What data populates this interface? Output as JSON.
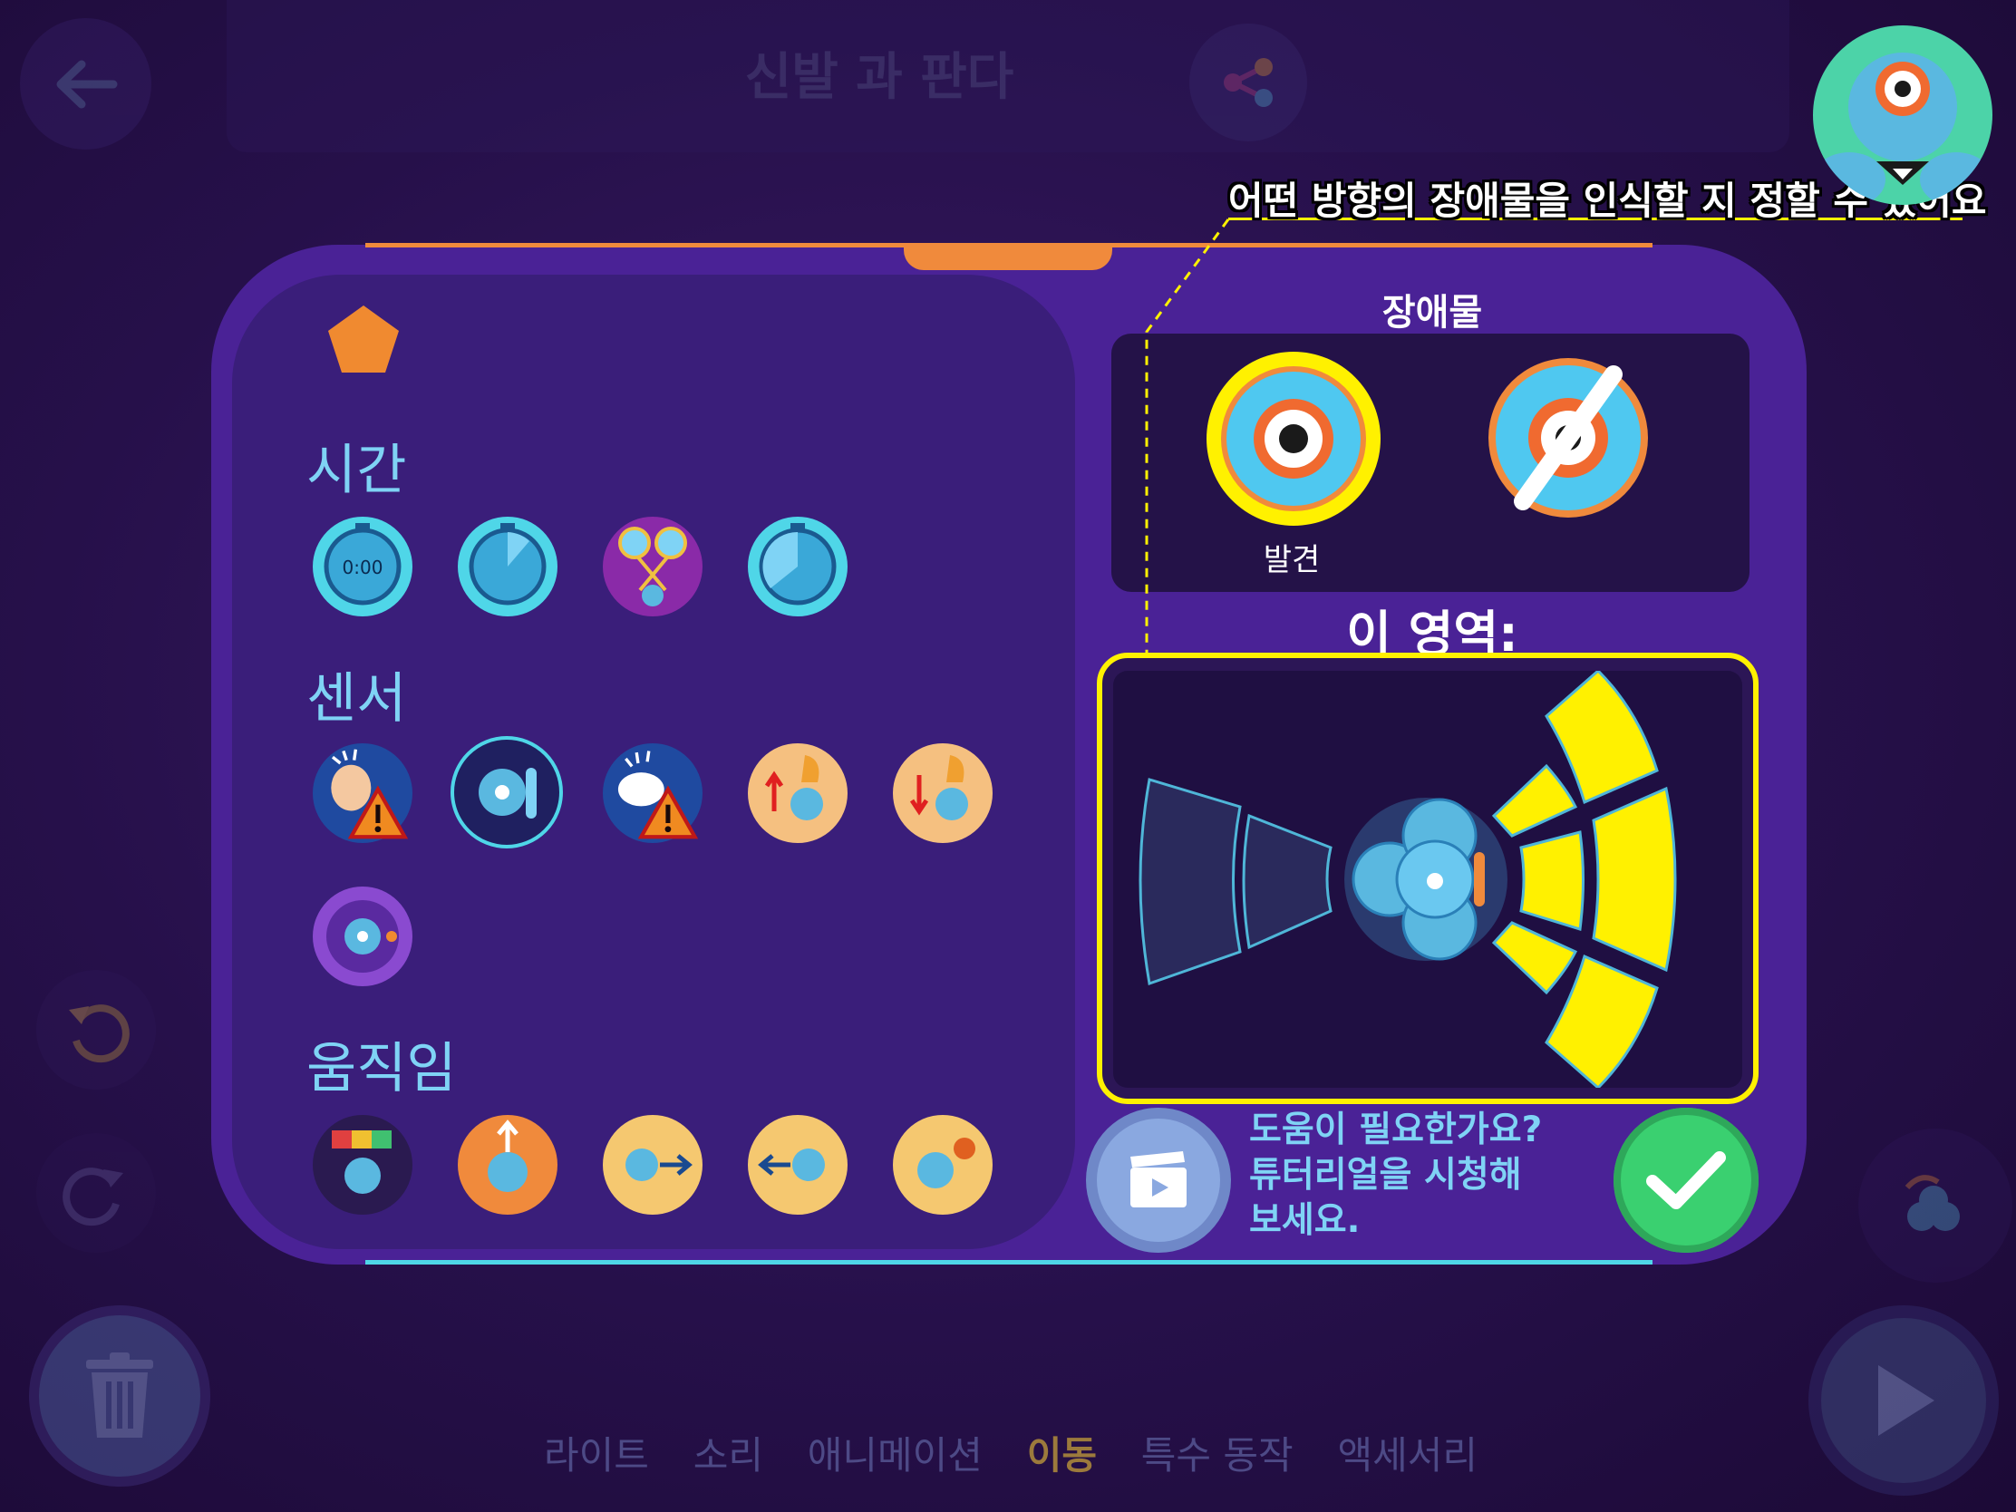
{
  "header": {
    "title": "신발 과 판다"
  },
  "tooltip": {
    "text": "어떤 방향의 장애물을 인식할 지 정할 수 있어요"
  },
  "panel": {
    "sections": {
      "time": "시간",
      "sensor": "센서",
      "movement": "움직임"
    },
    "time_badge": "0:00"
  },
  "obstacle": {
    "title": "장애물",
    "options": [
      {
        "label": "발견",
        "selected": true
      },
      {
        "label": "",
        "selected": false
      }
    ]
  },
  "zone": {
    "label": "이 영역:",
    "segments": {
      "back_outer": false,
      "back_inner": false,
      "front_top_inner": true,
      "front_top_outer": true,
      "front_mid_inner": true,
      "front_mid_outer": true,
      "front_bottom_inner": true,
      "front_bottom_outer": true
    }
  },
  "help": {
    "line1": "도움이 필요한가요?",
    "line2": "튜터리얼을 시청해",
    "line3": "보세요."
  },
  "categories": [
    {
      "label": "라이트",
      "active": false
    },
    {
      "label": "소리",
      "active": false
    },
    {
      "label": "애니메이션",
      "active": false
    },
    {
      "label": "이동",
      "active": true
    },
    {
      "label": "특수 동작",
      "active": false
    },
    {
      "label": "액세서리",
      "active": false
    }
  ],
  "colors": {
    "accent_yellow": "#fff100",
    "accent_orange": "#f08a3c",
    "accent_cyan": "#4fd6e8",
    "confirm_green": "#3ad070"
  },
  "icons": [
    "back-arrow-icon",
    "share-icon",
    "undo-icon",
    "redo-icon",
    "trash-icon",
    "group-icon",
    "play-icon",
    "video-clapper-icon",
    "checkmark-icon",
    "pentagon-icon"
  ]
}
